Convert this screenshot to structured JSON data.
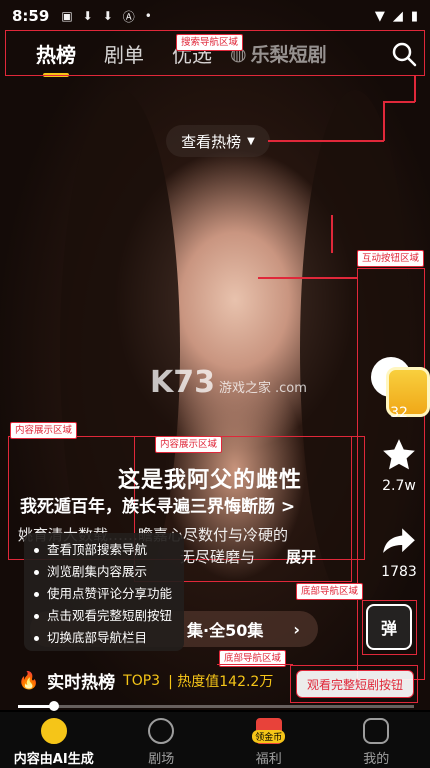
{
  "status_bar": {
    "time": "8:59"
  },
  "top_nav": {
    "tabs": [
      "热榜",
      "剧单",
      "优选"
    ],
    "active_tab": "热榜",
    "logo_text": "乐梨短剧",
    "annotation": "搜索导航区域"
  },
  "hot_pill": {
    "label": "查看热榜"
  },
  "annotations": {
    "interaction": "互动按钮区域",
    "content_left": "内容展示区域",
    "content_center": "内容展示区域",
    "bottom_nav_right": "底部导航区域",
    "bottom_nav_center": "底部导航区域"
  },
  "watermark": {
    "main": "K73",
    "sub": "游戏之家",
    "domain": ".com"
  },
  "rail": {
    "comment_count": "32",
    "like_count": "2.7w",
    "share_count": "1783",
    "danmu_label": "弹"
  },
  "drama": {
    "title": "这是我阿父的雌性",
    "subtitle": "我死遁百年，族长寻遍三界悔断肠 >",
    "desc_line1": "姚育清大数载……瞻嘉心尽数付与冷硬的",
    "desc_line2": "无尽磋磨与",
    "expand": "展开",
    "episodes": "集·全50集"
  },
  "tooltip": {
    "items": [
      "查看顶部搜索导航",
      "浏览剧集内容展示",
      "使用点赞评论分享功能",
      "点击观看完整短剧按钮",
      "切换底部导航栏目"
    ]
  },
  "hotbar": {
    "label": "实时热榜",
    "rank": "TOP3",
    "heat": "| 热度值142.2万"
  },
  "watch_button": "观看完整短剧按钮",
  "progress": {
    "fraction": 0.09
  },
  "bottom_nav": {
    "items": [
      "内容由AI生成",
      "剧场",
      "福利",
      "我的"
    ],
    "badge": "领金币"
  },
  "colors": {
    "accent": "#f5c518",
    "annotation": "#e0283a"
  }
}
